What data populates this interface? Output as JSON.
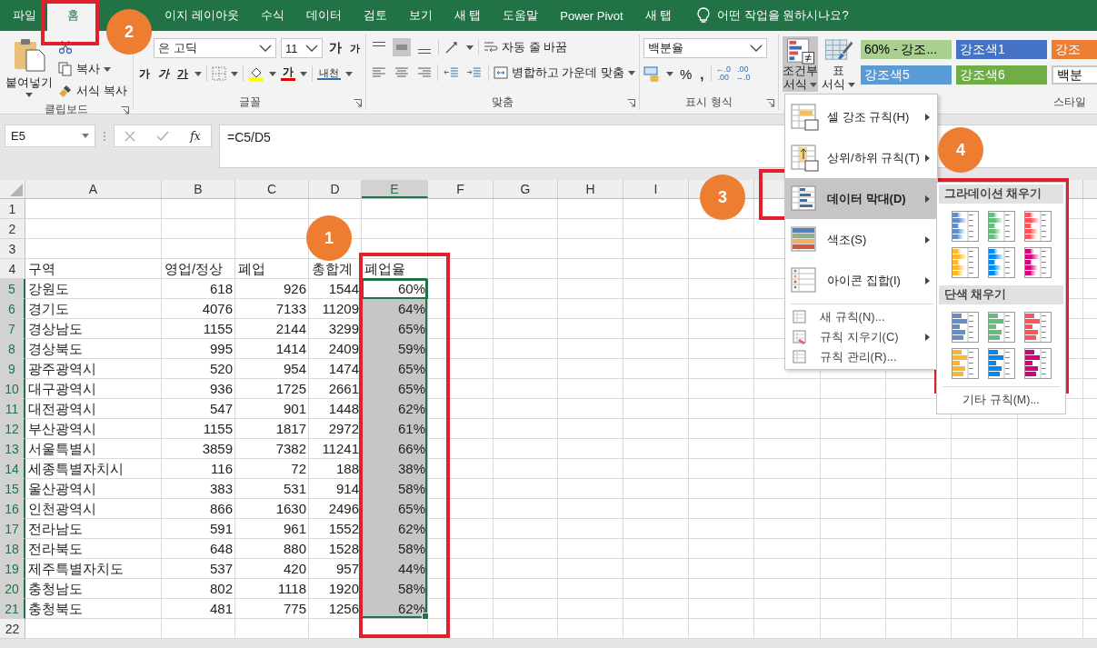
{
  "ribbon_tabs": [
    {
      "label": "파일",
      "selected": false
    },
    {
      "label": "홈",
      "selected": true
    },
    {
      "label": "이지 레이아웃",
      "selected": false
    },
    {
      "label": "수식",
      "selected": false
    },
    {
      "label": "데이터",
      "selected": false
    },
    {
      "label": "검토",
      "selected": false
    },
    {
      "label": "보기",
      "selected": false
    },
    {
      "label": "새 탭",
      "selected": false
    },
    {
      "label": "도움말",
      "selected": false
    },
    {
      "label": "Power Pivot",
      "selected": false
    },
    {
      "label": "새 탭",
      "selected": false
    }
  ],
  "tell_me": "어떤 작업을 원하시나요?",
  "clipboard": {
    "paste": "붙여넣기",
    "copy": "복사",
    "format_painter": "서식 복사",
    "label": "클립보드"
  },
  "font": {
    "name": "은 고딕",
    "size": "11",
    "grow": "가",
    "shrink": "가",
    "bold": "가",
    "italic": "가",
    "underline": "가",
    "font_color": "가",
    "phonetic": "내천",
    "label": "글꼴"
  },
  "alignment": {
    "wrap": "자동 줄 바꿈",
    "merge": "병합하고 가운데 맞춤",
    "label": "맞춤"
  },
  "number": {
    "format": "백분율",
    "percent": "%",
    "comma": ",",
    "increase_decimal": [
      "←.0",
      ".00"
    ],
    "decrease_decimal": [
      ".00",
      "→.0"
    ],
    "label": "표시 형식"
  },
  "styles": {
    "conditional": [
      "조건부",
      "서식"
    ],
    "table_format": [
      "표",
      "서식"
    ],
    "label": "스타일",
    "cell_styles": [
      {
        "label": "60% - 강조...",
        "color": "#a9d08e",
        "kind": "light"
      },
      {
        "label": "강조색1",
        "color": "#4472c4",
        "kind": "accent"
      },
      {
        "label": "강조",
        "color": "#ed7d31",
        "kind": "accent"
      },
      {
        "label": "강조색5",
        "color": "#5b9bd5",
        "kind": "accent"
      },
      {
        "label": "강조색6",
        "color": "#70ad47",
        "kind": "accent"
      },
      {
        "label": "백분",
        "color": "#ffffff",
        "kind": "light"
      }
    ]
  },
  "formula_bar": {
    "name_box": "E5",
    "function_label": "fx",
    "formula": "=C5/D5"
  },
  "columns": [
    {
      "label": "A",
      "selected": false
    },
    {
      "label": "B",
      "selected": false
    },
    {
      "label": "C",
      "selected": false
    },
    {
      "label": "D",
      "selected": false
    },
    {
      "label": "E",
      "selected": true
    },
    {
      "label": "F",
      "selected": false
    },
    {
      "label": "G",
      "selected": false
    },
    {
      "label": "H",
      "selected": false
    },
    {
      "label": "I",
      "selected": false
    }
  ],
  "rows": [
    {
      "n": "1",
      "selected": false,
      "active": false
    },
    {
      "n": "2",
      "selected": false,
      "active": false
    },
    {
      "n": "3",
      "selected": false,
      "active": false
    },
    {
      "n": "4",
      "cells": [
        "구역",
        "영업/정상",
        "폐업",
        "총합계",
        "폐업율"
      ],
      "selected": false,
      "active": false
    },
    {
      "n": "5",
      "cells": [
        "강원도",
        "618",
        "926",
        "1544",
        "60%"
      ],
      "selected": true,
      "active": true
    },
    {
      "n": "6",
      "cells": [
        "경기도",
        "4076",
        "7133",
        "11209",
        "64%"
      ],
      "selected": true,
      "active": false
    },
    {
      "n": "7",
      "cells": [
        "경상남도",
        "1155",
        "2144",
        "3299",
        "65%"
      ],
      "selected": true,
      "active": false
    },
    {
      "n": "8",
      "cells": [
        "경상북도",
        "995",
        "1414",
        "2409",
        "59%"
      ],
      "selected": true,
      "active": false
    },
    {
      "n": "9",
      "cells": [
        "광주광역시",
        "520",
        "954",
        "1474",
        "65%"
      ],
      "selected": true,
      "active": false
    },
    {
      "n": "10",
      "cells": [
        "대구광역시",
        "936",
        "1725",
        "2661",
        "65%"
      ],
      "selected": true,
      "active": false
    },
    {
      "n": "11",
      "cells": [
        "대전광역시",
        "547",
        "901",
        "1448",
        "62%"
      ],
      "selected": true,
      "active": false
    },
    {
      "n": "12",
      "cells": [
        "부산광역시",
        "1155",
        "1817",
        "2972",
        "61%"
      ],
      "selected": true,
      "active": false
    },
    {
      "n": "13",
      "cells": [
        "서울특별시",
        "3859",
        "7382",
        "11241",
        "66%"
      ],
      "selected": true,
      "active": false
    },
    {
      "n": "14",
      "cells": [
        "세종특별자치시",
        "116",
        "72",
        "188",
        "38%"
      ],
      "selected": true,
      "active": false
    },
    {
      "n": "15",
      "cells": [
        "울산광역시",
        "383",
        "531",
        "914",
        "58%"
      ],
      "selected": true,
      "active": false
    },
    {
      "n": "16",
      "cells": [
        "인천광역시",
        "866",
        "1630",
        "2496",
        "65%"
      ],
      "selected": true,
      "active": false
    },
    {
      "n": "17",
      "cells": [
        "전라남도",
        "591",
        "961",
        "1552",
        "62%"
      ],
      "selected": true,
      "active": false
    },
    {
      "n": "18",
      "cells": [
        "전라북도",
        "648",
        "880",
        "1528",
        "58%"
      ],
      "selected": true,
      "active": false
    },
    {
      "n": "19",
      "cells": [
        "제주특별자치도",
        "537",
        "420",
        "957",
        "44%"
      ],
      "selected": true,
      "active": false
    },
    {
      "n": "20",
      "cells": [
        "충청남도",
        "802",
        "1118",
        "1920",
        "58%"
      ],
      "selected": true,
      "active": false
    },
    {
      "n": "21",
      "cells": [
        "충청북도",
        "481",
        "775",
        "1256",
        "62%"
      ],
      "selected": true,
      "active": false
    },
    {
      "n": "22",
      "selected": false,
      "active": false
    }
  ],
  "menu": {
    "items": [
      {
        "label": "셀 강조 규칙(H)",
        "kind": "large",
        "submenu": true,
        "selected": false
      },
      {
        "label": "상위/하위 규칙(T)",
        "kind": "large",
        "submenu": true,
        "selected": false
      },
      {
        "label": "데이터 막대(D)",
        "kind": "large",
        "submenu": true,
        "selected": true
      },
      {
        "label": "색조(S)",
        "kind": "large",
        "submenu": true,
        "selected": false
      },
      {
        "label": "아이콘 집합(I)",
        "kind": "large",
        "submenu": true,
        "selected": false
      },
      {
        "label": "새 규칙(N)...",
        "kind": "small",
        "submenu": false,
        "selected": false
      },
      {
        "label": "규칙 지우기(C)",
        "kind": "small",
        "submenu": true,
        "selected": false
      },
      {
        "label": "규칙 관리(R)...",
        "kind": "small",
        "submenu": false,
        "selected": false
      }
    ]
  },
  "submenu": {
    "sections": [
      {
        "title": "그라데이션 채우기",
        "kind": "gradient",
        "swatches": [
          {
            "color": "#638ec6"
          },
          {
            "color": "#63be7b"
          },
          {
            "color": "#ff555a"
          },
          {
            "color": "#ffb628"
          },
          {
            "color": "#008aef"
          },
          {
            "color": "#d6007b"
          }
        ]
      },
      {
        "title": "단색 채우기",
        "kind": "solid",
        "swatches": [
          {
            "color": "#638ec6"
          },
          {
            "color": "#63be7b"
          },
          {
            "color": "#ff555a"
          },
          {
            "color": "#ffb628"
          },
          {
            "color": "#008aef"
          },
          {
            "color": "#d6007b"
          }
        ]
      }
    ],
    "more": "기타 규칙(M)..."
  },
  "callouts": [
    {
      "label": "1"
    },
    {
      "label": "2"
    },
    {
      "label": "3"
    },
    {
      "label": "4"
    }
  ]
}
